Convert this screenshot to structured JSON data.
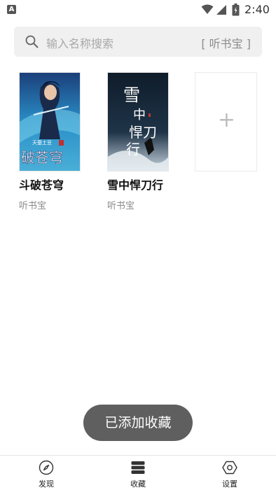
{
  "status_bar": {
    "notification_icon_letter": "A",
    "time": "2:40"
  },
  "search": {
    "placeholder": "输入名称搜索",
    "source_label": "[ 听书宝 ]"
  },
  "books": [
    {
      "title": "斗破苍穹",
      "source": "听书宝",
      "cover_icon": "book-cover-art",
      "cover_text": "破苍穹",
      "cover_author": "天蚕土豆"
    },
    {
      "title": "雪中悍刀行",
      "source": "听书宝",
      "cover_icon": "book-cover-art",
      "cover_text": "雪中悍刀行"
    }
  ],
  "add_book": {
    "symbol": "+"
  },
  "toast": {
    "message": "已添加收藏"
  },
  "nav": {
    "items": [
      {
        "label": "发现",
        "icon": "compass-icon"
      },
      {
        "label": "收藏",
        "icon": "bookshelf-icon"
      },
      {
        "label": "设置",
        "icon": "settings-icon"
      }
    ]
  },
  "colors": {
    "background": "#ffffff",
    "search_bg": "#f0f0f0",
    "toast_bg": "#5f5f5f"
  }
}
